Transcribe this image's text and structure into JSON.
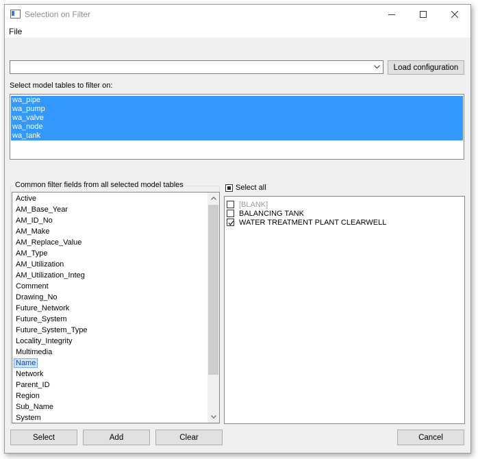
{
  "window": {
    "title": "Selection on Filter"
  },
  "menu": {
    "file": "File"
  },
  "config": {
    "combo_value": "",
    "load_button": "Load configuration"
  },
  "tables": {
    "label": "Select model tables to filter on:",
    "items": [
      "wa_pipe",
      "wa_pump",
      "wa_valve",
      "wa_node",
      "wa_tank"
    ]
  },
  "fields": {
    "label": "Common filter fields from all selected model tables",
    "items": [
      "Active",
      "AM_Base_Year",
      "AM_ID_No",
      "AM_Make",
      "AM_Replace_Value",
      "AM_Type",
      "AM_Utilization",
      "AM_Utilization_Integ",
      "Comment",
      "Drawing_No",
      "Future_Network",
      "Future_System",
      "Future_System_Type",
      "Locality_Integrity",
      "Multimedia",
      "Name",
      "Network",
      "Parent_ID",
      "Region",
      "Sub_Name",
      "System"
    ],
    "selected": "Name"
  },
  "values": {
    "select_all": "Select all",
    "items": [
      {
        "label": "[BLANK]",
        "checked": false
      },
      {
        "label": "BALANCING TANK",
        "checked": false
      },
      {
        "label": "WATER TREATMENT PLANT CLEARWELL",
        "checked": true
      }
    ]
  },
  "buttons": {
    "select": "Select",
    "add": "Add",
    "clear": "Clear",
    "cancel": "Cancel"
  }
}
